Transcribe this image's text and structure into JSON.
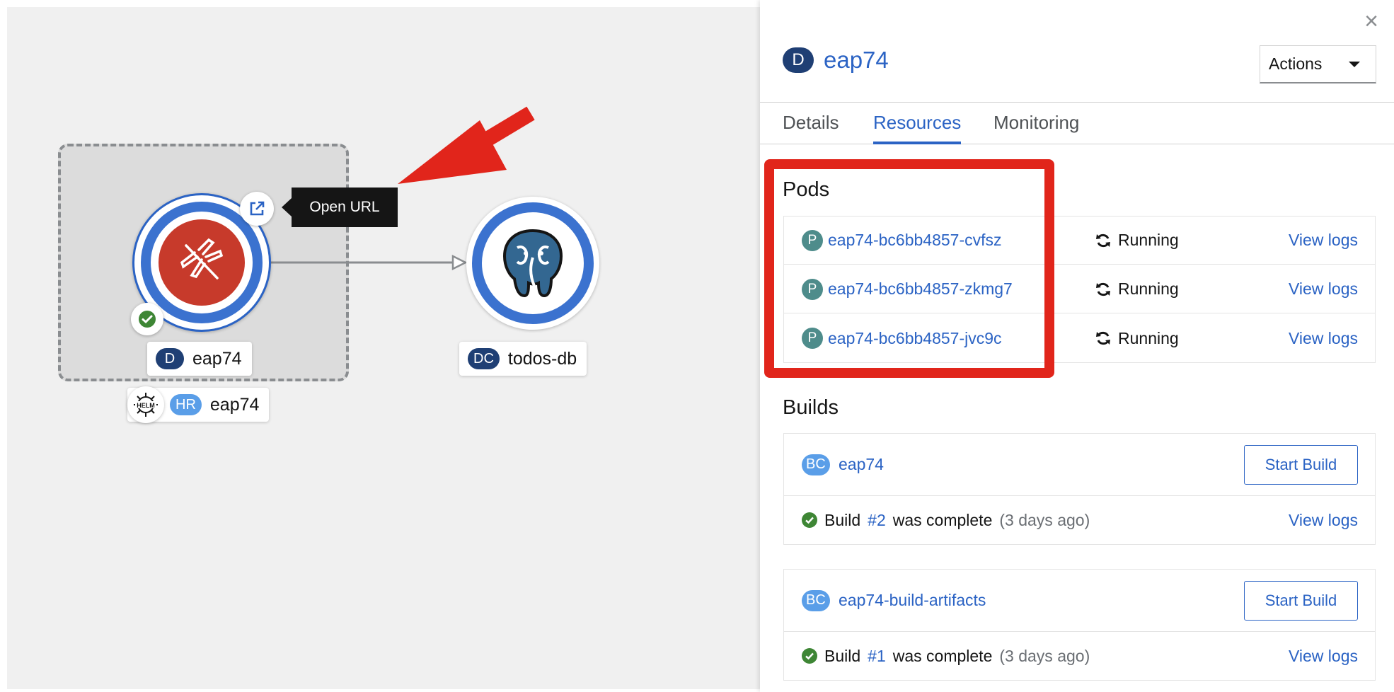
{
  "topology": {
    "tooltip": "Open URL",
    "nodes": {
      "eap": {
        "badge": "D",
        "name": "eap74"
      },
      "db": {
        "badge": "DC",
        "name": "todos-db"
      },
      "helm": {
        "icon_text": "HELM",
        "badge": "HR",
        "name": "eap74"
      }
    },
    "icons": [
      "external-link-icon",
      "check-circle-icon",
      "dragonfly-icon",
      "postgresql-elephant-icon",
      "helm-icon"
    ]
  },
  "panel": {
    "close": "×",
    "title_badge": "D",
    "title": "eap74",
    "actions_label": "Actions",
    "tabs": [
      "Details",
      "Resources",
      "Monitoring"
    ],
    "active_tab": "Resources",
    "pods_title": "Pods",
    "pods": [
      {
        "badge": "P",
        "name": "eap74-bc6bb4857-cvfsz",
        "status": "Running",
        "action": "View logs"
      },
      {
        "badge": "P",
        "name": "eap74-bc6bb4857-zkmg7",
        "status": "Running",
        "action": "View logs"
      },
      {
        "badge": "P",
        "name": "eap74-bc6bb4857-jvc9c",
        "status": "Running",
        "action": "View logs"
      }
    ],
    "builds_title": "Builds",
    "builds": [
      {
        "badge": "BC",
        "name": "eap74",
        "button": "Start Build",
        "status_prefix": "Build",
        "number": "#2",
        "status_text": "was complete",
        "ago": "(3 days ago)",
        "action": "View logs"
      },
      {
        "badge": "BC",
        "name": "eap74-build-artifacts",
        "button": "Start Build",
        "status_prefix": "Build",
        "number": "#1",
        "status_text": "was complete",
        "ago": "(3 days ago)",
        "action": "View logs"
      }
    ]
  },
  "colors": {
    "link": "#2b63c4",
    "badge_dark": "#1f3f74",
    "badge_light": "#5a9ee8",
    "pod_badge": "#4e8c8b",
    "success": "#3e8635",
    "annotation_red": "#e1251b"
  }
}
